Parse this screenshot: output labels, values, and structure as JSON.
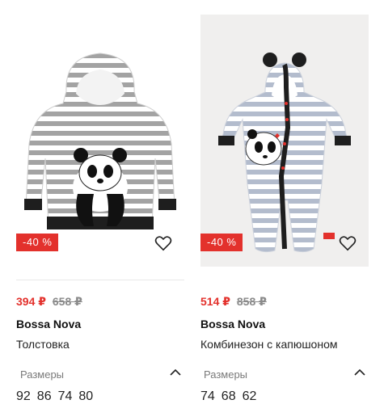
{
  "products": [
    {
      "discount": "-40 %",
      "price_new": "394 ₽",
      "price_old": "658 ₽",
      "brand": "Bossa Nova",
      "name": "Толстовка",
      "sizes_label": "Размеры",
      "sizes": [
        "92",
        "86",
        "74",
        "80"
      ],
      "image_icon": "striped-panda-hoodie"
    },
    {
      "discount": "-40 %",
      "price_new": "514 ₽",
      "price_old": "858 ₽",
      "brand": "Bossa Nova",
      "name": "Комбинезон с капюшоном",
      "sizes_label": "Размеры",
      "sizes": [
        "74",
        "68",
        "62"
      ],
      "image_icon": "striped-panda-romper"
    }
  ],
  "colors": {
    "accent": "#e3312c",
    "stripe": "#9c9c9c",
    "text": "#1a1a1a",
    "muted": "#7a7a7a"
  }
}
